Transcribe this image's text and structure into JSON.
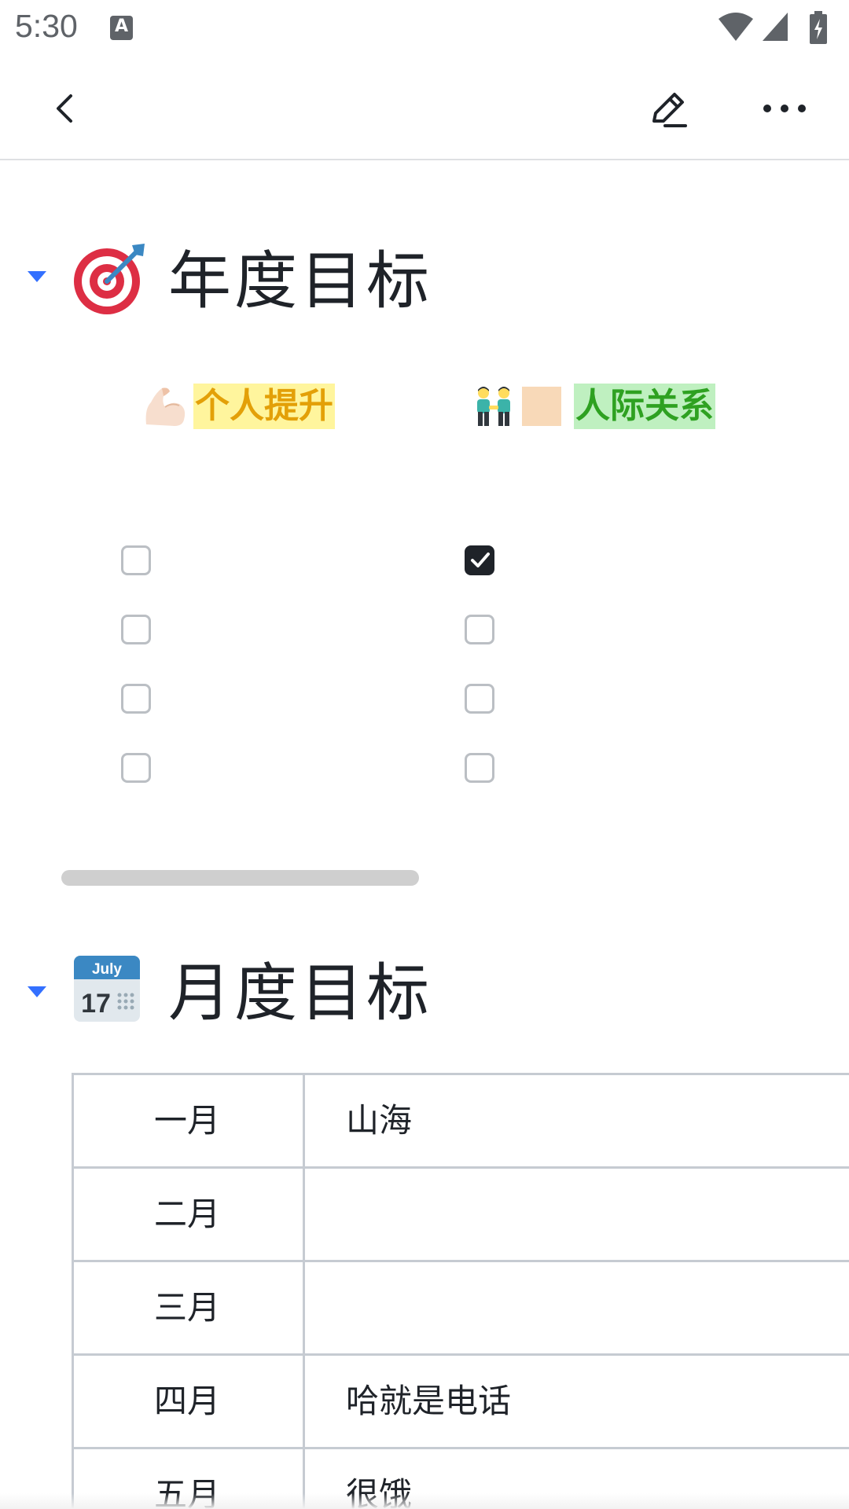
{
  "status_bar": {
    "time": "5:30",
    "keyboard_indicator": "A",
    "icons": [
      "wifi-icon",
      "cell-signal-icon",
      "battery-charging-icon"
    ]
  },
  "app_bar": {
    "icons": [
      "back-arrow-icon",
      "edit-pencil-icon",
      "more-dots-icon"
    ]
  },
  "sections": [
    {
      "emoji": "direct-hit-target-emoji",
      "title": "年度目标"
    },
    {
      "emoji": "calendar-july-17-emoji",
      "calendar_month": "July",
      "calendar_day": "17",
      "title": "月度目标"
    }
  ],
  "categories": [
    {
      "emoji": "flexed-biceps-emoji",
      "label": "个人提升",
      "highlight": "#fff59d",
      "text_color": "#e3a008"
    },
    {
      "emoji": "two-men-holding-hands-emoji",
      "label": "人际关系",
      "highlight": "#bff0c0",
      "text_color": "#2ea121"
    }
  ],
  "checklists": {
    "personal": [
      false,
      false,
      false,
      false
    ],
    "relationships": [
      true,
      false,
      false,
      false
    ]
  },
  "monthly_table": {
    "rows": [
      {
        "month": "一月",
        "goal": "山海"
      },
      {
        "month": "二月",
        "goal": ""
      },
      {
        "month": "三月",
        "goal": ""
      },
      {
        "month": "四月",
        "goal": "哈就是电话"
      },
      {
        "month": "五月",
        "goal": "很饿"
      }
    ]
  },
  "colors": {
    "accent_caret": "#3370ff",
    "text_primary": "#1f2329",
    "checkbox_border": "#bbbfc4",
    "table_border": "#c6cbd2"
  }
}
